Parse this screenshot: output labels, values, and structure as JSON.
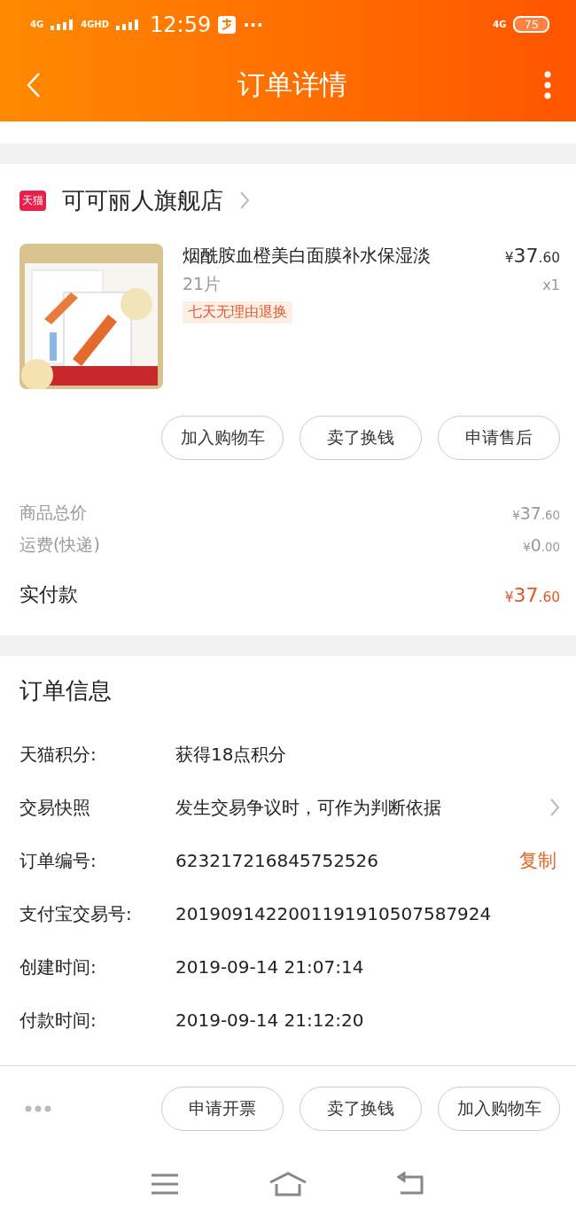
{
  "status_bar": {
    "network_1": "4G",
    "network_2": "4GHD",
    "time": "12:59",
    "more": "···",
    "data": "4G",
    "battery": "75"
  },
  "header": {
    "title": "订单详情"
  },
  "store": {
    "badge": "天猫",
    "name": "可可丽人旗舰店"
  },
  "product": {
    "kind": "picture",
    "title": "烟酰胺血橙美白面膜补水保湿淡",
    "spec": "21片",
    "price": {
      "symbol": "¥",
      "main": "37",
      "decimal": ".60"
    },
    "quantity": "x1",
    "tag": "七天无理由退换"
  },
  "product_actions": [
    "加入购物车",
    "卖了换钱",
    "申请售后"
  ],
  "summary": [
    {
      "kind": "normal",
      "label": "商品总价",
      "price": {
        "symbol": "¥",
        "main": "37",
        "decimal": ".60"
      }
    },
    {
      "kind": "normal",
      "label": "运费(快递)",
      "price": {
        "symbol": "¥",
        "main": "0",
        "decimal": ".00"
      }
    },
    {
      "kind": "total",
      "label": "实付款",
      "price": {
        "symbol": "¥",
        "main": "37",
        "decimal": ".60"
      }
    }
  ],
  "order_info": {
    "title": "订单信息",
    "rows": [
      {
        "kind": "plain",
        "label": "天猫积分:",
        "value": "获得18点积分"
      },
      {
        "kind": "chevron",
        "label": "交易快照",
        "value": "发生交易争议时，可作为判断依据"
      },
      {
        "kind": "copy",
        "label": "订单编号:",
        "value": "623217216845752526",
        "action": "复制"
      },
      {
        "kind": "plain",
        "label": "支付宝交易号:",
        "value": "2019091422001191910507587924"
      },
      {
        "kind": "plain",
        "label": "创建时间:",
        "value": "2019-09-14 21:07:14"
      },
      {
        "kind": "plain",
        "label": "付款时间:",
        "value": "2019-09-14 21:12:20"
      }
    ]
  },
  "bottom_actions": [
    "申请开票",
    "卖了换钱",
    "加入购物车"
  ]
}
